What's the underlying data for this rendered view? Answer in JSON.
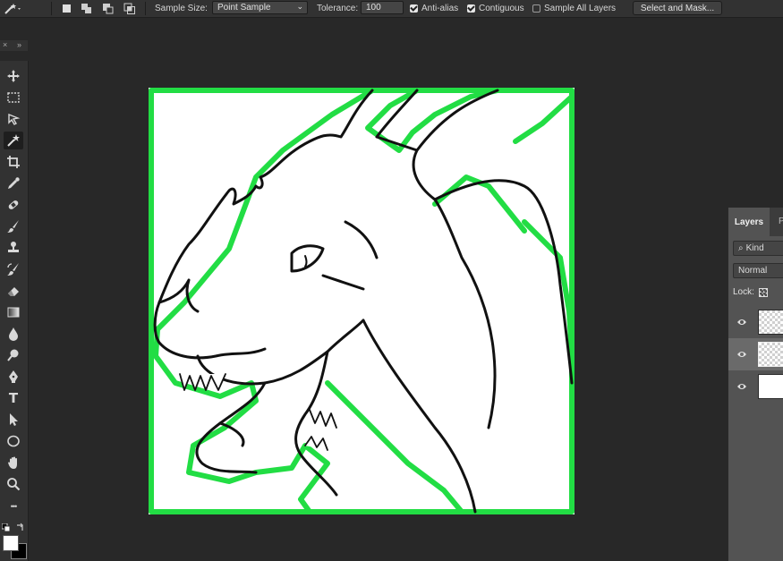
{
  "options_bar": {
    "tool_icon": "magic-wand-icon",
    "sample_size_label": "Sample Size:",
    "sample_size_value": "Point Sample",
    "tolerance_label": "Tolerance:",
    "tolerance_value": "100",
    "anti_alias_label": "Anti-alias",
    "anti_alias_checked": true,
    "contiguous_label": "Contiguous",
    "contiguous_checked": true,
    "sample_all_layers_label": "Sample All Layers",
    "sample_all_layers_checked": false,
    "select_mask_button": "Select and Mask..."
  },
  "toolbar": {
    "collapse_glyph": "»",
    "close_glyph": "×",
    "type_tool_glyph": "T",
    "more_glyph": "•••",
    "tools": [
      "move-icon",
      "marquee-icon",
      "lasso-icon",
      "magic-wand-icon",
      "crop-icon",
      "eyedropper-icon",
      "healing-brush-icon",
      "brush-icon",
      "clone-stamp-icon",
      "history-brush-icon",
      "eraser-icon",
      "gradient-icon",
      "blur-icon",
      "dodge-icon",
      "pen-icon",
      "type-icon",
      "path-selection-icon",
      "ellipse-icon",
      "hand-icon",
      "zoom-icon",
      "more-tools-icon"
    ],
    "active_tool": "magic-wand-icon",
    "foreground_color": "#ffffff",
    "background_color": "#000000"
  },
  "canvas": {
    "selection_color": "#22dd44"
  },
  "layers_panel": {
    "tab_label": "Layers",
    "second_tab_partial": "P",
    "filter_label": "Kind",
    "blend_mode": "Normal",
    "lock_label": "Lock:",
    "layers": [
      {
        "thumbnail": "transparent-sketch"
      },
      {
        "thumbnail": "transparent-selected"
      },
      {
        "thumbnail": "white-background"
      }
    ]
  }
}
